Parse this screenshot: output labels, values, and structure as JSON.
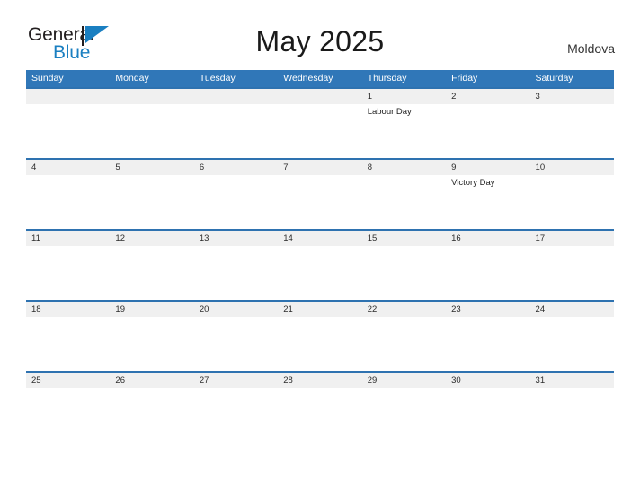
{
  "brand": {
    "line1": "General",
    "line2": "Blue",
    "flag_icon": "triangle-flag-icon",
    "color_dark": "#231f20",
    "color_blue": "#1a7fc1"
  },
  "header": {
    "title": "May 2025",
    "country": "Moldova"
  },
  "colors": {
    "header_blue": "#3077b8",
    "row_divider_blue": "#2e72b0",
    "day_strip_gray": "#f0f0f0",
    "text_dark": "#1f1f1f"
  },
  "calendar": {
    "weekdays": [
      "Sunday",
      "Monday",
      "Tuesday",
      "Wednesday",
      "Thursday",
      "Friday",
      "Saturday"
    ],
    "weeks": [
      {
        "days": [
          {
            "num": "",
            "event": ""
          },
          {
            "num": "",
            "event": ""
          },
          {
            "num": "",
            "event": ""
          },
          {
            "num": "",
            "event": ""
          },
          {
            "num": "1",
            "event": "Labour Day"
          },
          {
            "num": "2",
            "event": ""
          },
          {
            "num": "3",
            "event": ""
          }
        ]
      },
      {
        "days": [
          {
            "num": "4",
            "event": ""
          },
          {
            "num": "5",
            "event": ""
          },
          {
            "num": "6",
            "event": ""
          },
          {
            "num": "7",
            "event": ""
          },
          {
            "num": "8",
            "event": ""
          },
          {
            "num": "9",
            "event": "Victory Day"
          },
          {
            "num": "10",
            "event": ""
          }
        ]
      },
      {
        "days": [
          {
            "num": "11",
            "event": ""
          },
          {
            "num": "12",
            "event": ""
          },
          {
            "num": "13",
            "event": ""
          },
          {
            "num": "14",
            "event": ""
          },
          {
            "num": "15",
            "event": ""
          },
          {
            "num": "16",
            "event": ""
          },
          {
            "num": "17",
            "event": ""
          }
        ]
      },
      {
        "days": [
          {
            "num": "18",
            "event": ""
          },
          {
            "num": "19",
            "event": ""
          },
          {
            "num": "20",
            "event": ""
          },
          {
            "num": "21",
            "event": ""
          },
          {
            "num": "22",
            "event": ""
          },
          {
            "num": "23",
            "event": ""
          },
          {
            "num": "24",
            "event": ""
          }
        ]
      },
      {
        "days": [
          {
            "num": "25",
            "event": ""
          },
          {
            "num": "26",
            "event": ""
          },
          {
            "num": "27",
            "event": ""
          },
          {
            "num": "28",
            "event": ""
          },
          {
            "num": "29",
            "event": ""
          },
          {
            "num": "30",
            "event": ""
          },
          {
            "num": "31",
            "event": ""
          }
        ]
      }
    ]
  }
}
